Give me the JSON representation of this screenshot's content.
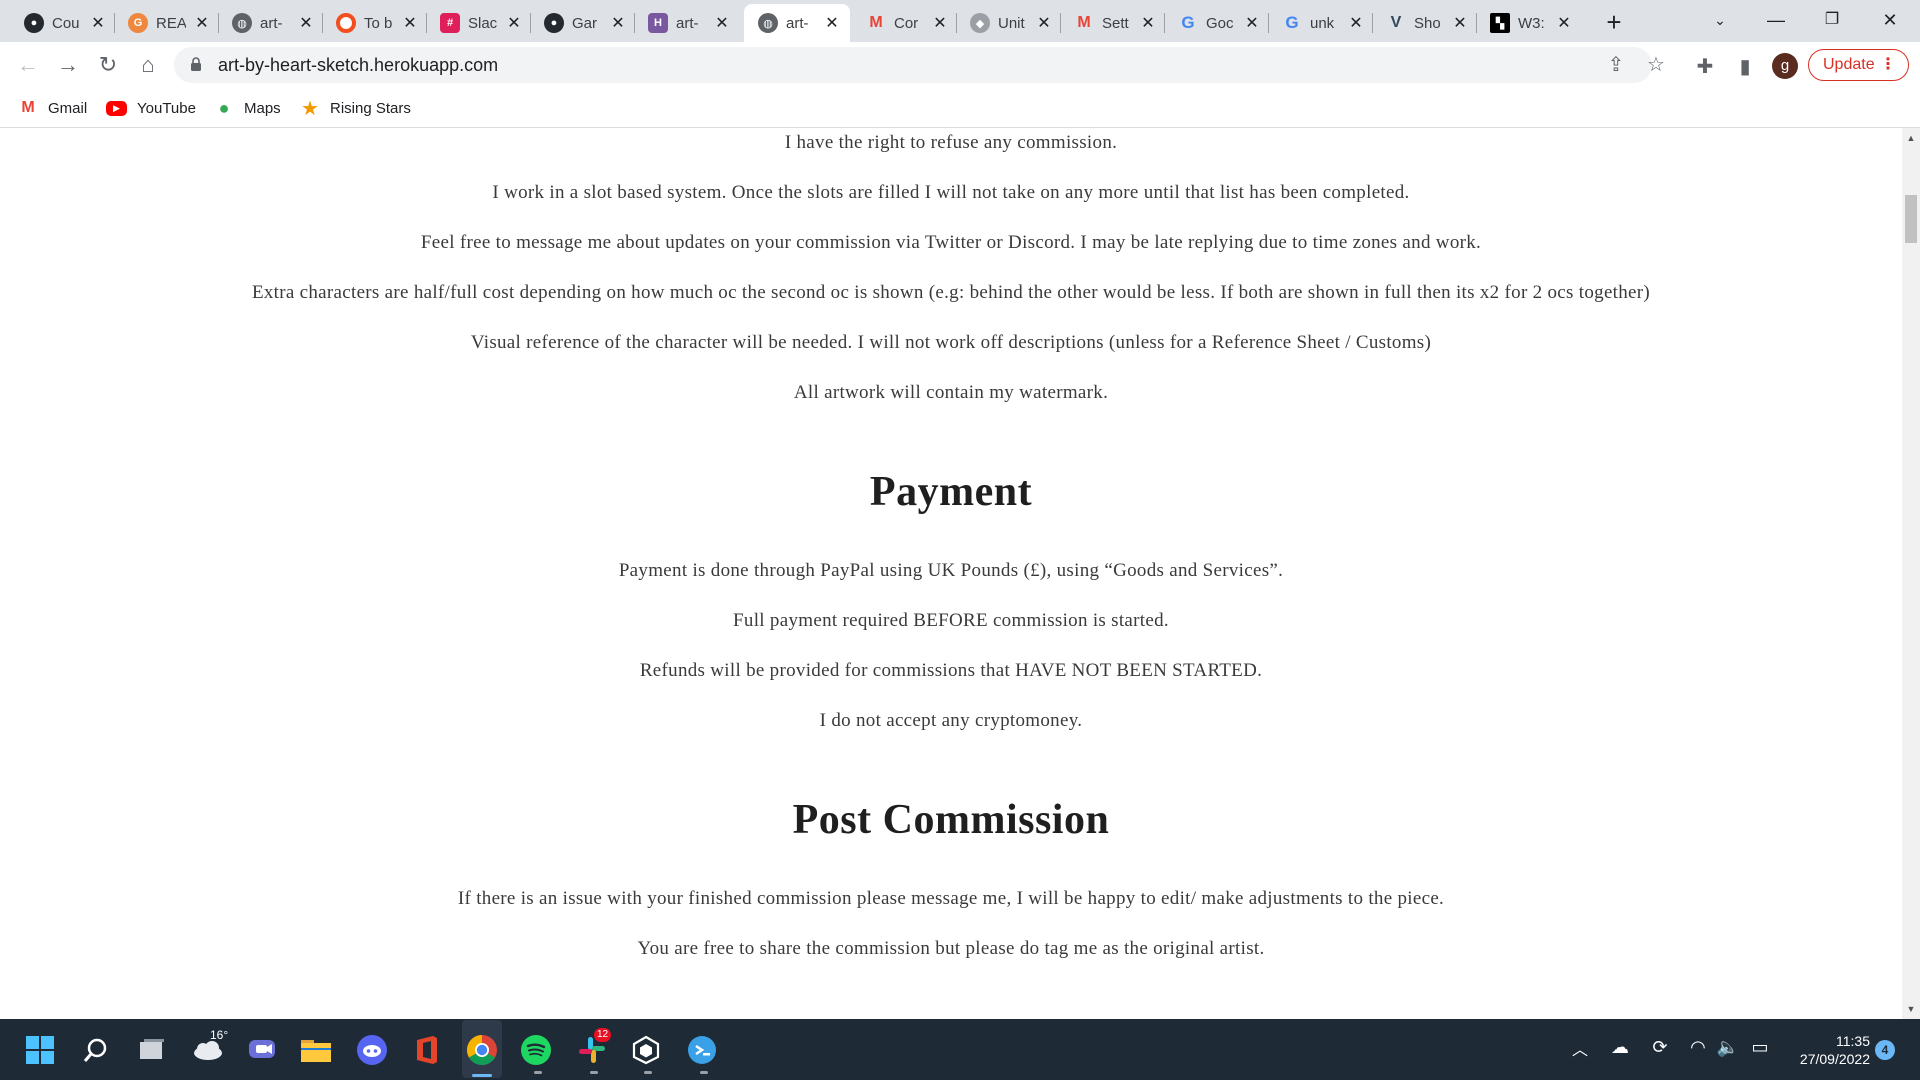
{
  "browser": {
    "tabs": [
      {
        "title": "Cou",
        "icon": "github-icon",
        "color": "#24292f"
      },
      {
        "title": "REA",
        "icon": "grammarly-icon",
        "color": "#f0873e"
      },
      {
        "title": "art-",
        "icon": "globe-icon",
        "color": "#5f6368"
      },
      {
        "title": "To b",
        "icon": "circle-icon",
        "color": "#f24e1e"
      },
      {
        "title": "Slac",
        "icon": "slack-icon",
        "color": "#e01e5a"
      },
      {
        "title": "Gar",
        "icon": "github-icon",
        "color": "#24292f"
      },
      {
        "title": "art-",
        "icon": "heroku-icon",
        "color": "#79589f"
      },
      {
        "title": "art-",
        "icon": "globe-icon",
        "color": "#5f6368",
        "active": true
      },
      {
        "title": "Cor",
        "icon": "gmail-icon",
        "color": "#ea4335"
      },
      {
        "title": "Unit",
        "icon": "unity-icon",
        "color": "#9aa0a6"
      },
      {
        "title": "Sett",
        "icon": "gmail-icon",
        "color": "#ea4335"
      },
      {
        "title": "Goc",
        "icon": "google-icon",
        "color": "#4285f4"
      },
      {
        "title": "unk",
        "icon": "google-icon",
        "color": "#4285f4"
      },
      {
        "title": "Sho",
        "icon": "vue-icon",
        "color": "#41b883"
      },
      {
        "title": "W3:",
        "icon": "w3c-icon",
        "color": "#000000"
      }
    ],
    "url": "art-by-heart-sketch.herokuapp.com",
    "update_label": "Update",
    "avatar_letter": "g",
    "bookmarks": [
      {
        "label": "Gmail",
        "icon": "gmail-icon"
      },
      {
        "label": "YouTube",
        "icon": "youtube-icon"
      },
      {
        "label": "Maps",
        "icon": "maps-icon"
      },
      {
        "label": "Rising Stars",
        "icon": "star-icon"
      }
    ]
  },
  "page": {
    "rules": [
      "I have the right to refuse any commission.",
      "I work in a slot based system. Once the slots are filled I will not take on any more until that list has been completed.",
      "Feel free to message me about updates on your commission via Twitter or Discord. I may be late replying due to time zones and work.",
      "Extra characters are half/full cost depending on how much oc the second oc is shown (e.g: behind the other would be less. If both are shown in full then its x2 for 2 ocs together)",
      "Visual reference of the character will be needed. I will not work off descriptions (unless for a Reference Sheet / Customs)",
      "All artwork will contain my watermark."
    ],
    "payment_heading": "Payment",
    "payment": [
      "Payment is done through PayPal using UK Pounds (£), using “Goods and Services”.",
      "Full payment required BEFORE commission is started.",
      "Refunds will be provided for commissions that HAVE NOT BEEN STARTED.",
      "I do not accept any cryptomoney."
    ],
    "post_heading": "Post Commission",
    "post": [
      "If there is an issue with your finished commission please message me, I will be happy to edit/ make adjustments to the piece.",
      "You are free to share the commission but please do tag me as the original artist."
    ]
  },
  "taskbar": {
    "weather_temp": "16°",
    "slack_badge": "12",
    "time": "11:35",
    "date": "27/09/2022",
    "notifications": "4"
  }
}
